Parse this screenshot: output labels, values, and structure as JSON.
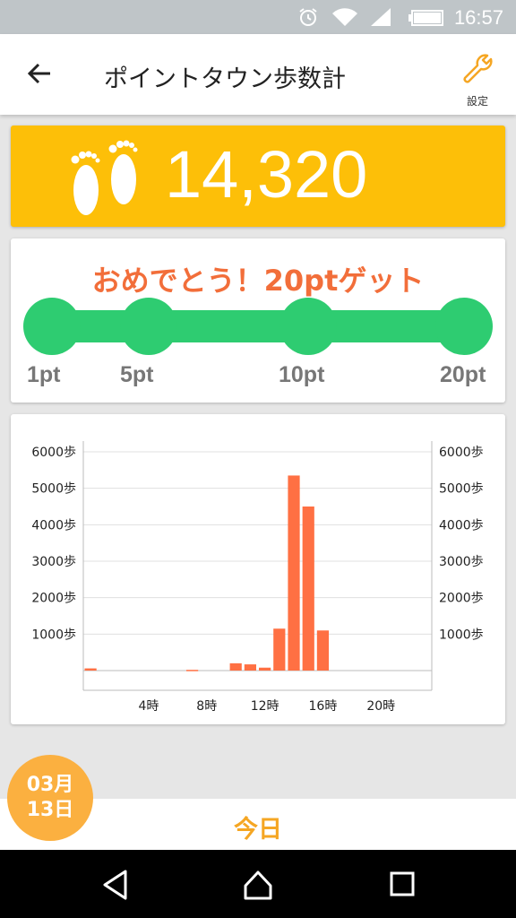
{
  "status_bar": {
    "time": "16:57"
  },
  "header": {
    "title": "ポイントタウン歩数計",
    "settings_label": "設定"
  },
  "steps": {
    "count": "14,320"
  },
  "points": {
    "message": "おめでとう！20ptゲット",
    "milestones": [
      {
        "label": "1pt"
      },
      {
        "label": "5pt"
      },
      {
        "label": "10pt"
      },
      {
        "label": "20pt"
      }
    ]
  },
  "chart_data": {
    "type": "bar",
    "x": [
      0,
      1,
      2,
      3,
      4,
      5,
      6,
      7,
      8,
      9,
      10,
      11,
      12,
      13,
      14,
      15,
      16,
      17,
      18,
      19,
      20,
      21,
      22,
      23
    ],
    "values": [
      60,
      0,
      0,
      0,
      0,
      0,
      0,
      20,
      0,
      0,
      200,
      170,
      80,
      1150,
      5350,
      4500,
      1100,
      0,
      0,
      0,
      0,
      0,
      0,
      0
    ],
    "x_tick_labels": [
      {
        "x": 4,
        "label": "4時"
      },
      {
        "x": 8,
        "label": "8時"
      },
      {
        "x": 12,
        "label": "12時"
      },
      {
        "x": 16,
        "label": "16時"
      },
      {
        "x": 20,
        "label": "20時"
      }
    ],
    "y_tick_labels": [
      {
        "y": 1000,
        "label": "1000歩"
      },
      {
        "y": 2000,
        "label": "2000歩"
      },
      {
        "y": 3000,
        "label": "3000歩"
      },
      {
        "y": 4000,
        "label": "4000歩"
      },
      {
        "y": 5000,
        "label": "5000歩"
      },
      {
        "y": 6000,
        "label": "6000歩"
      }
    ],
    "ylim": [
      0,
      6000
    ],
    "bar_color": "#ff7043",
    "grid": true
  },
  "bottom": {
    "today_label": "今日"
  },
  "date_badge": {
    "month": "03月",
    "day": "13日"
  },
  "colors": {
    "accent": "#fdbf08",
    "progress": "#2ecc71",
    "message": "#f26e3a",
    "badge": "#fbb040"
  }
}
